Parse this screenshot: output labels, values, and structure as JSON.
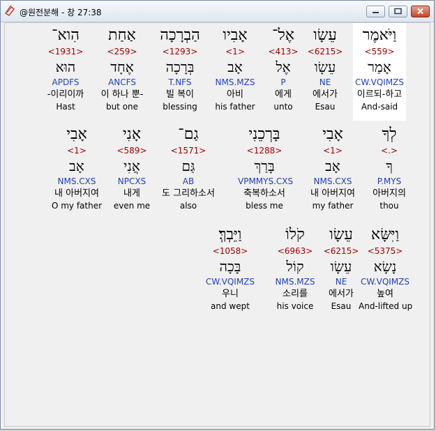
{
  "window": {
    "title": "@원전분해 - 창 27:38"
  },
  "colors": {
    "strong": "#a00000",
    "parse": "#1f3fb8",
    "selected_bg": "#ffffff"
  },
  "rows": [
    [
      {
        "heb": "וַיֹּאמֶר",
        "strong": "<559>",
        "lex": "אָמַר",
        "parse": "CW.VQIMZS",
        "kor": "이르되-하고",
        "eng": "And-said",
        "selected": true
      },
      {
        "heb": "עֵשָׂו",
        "strong": "<6215>",
        "lex": "עֵשָׂו",
        "parse": "NE",
        "kor": "에서가",
        "eng": "Esau"
      },
      {
        "heb": "אֶל־",
        "strong": "<413>",
        "lex": "אֶל",
        "parse": "P",
        "kor": "에게",
        "eng": "unto"
      },
      {
        "heb": "אָבִיו",
        "strong": "<1>",
        "lex": "אָב",
        "parse": "NMS.MZS",
        "kor": "아비",
        "eng": "his father"
      },
      {
        "heb": "הַבְרָכָה",
        "strong": "<1293>",
        "lex": "בְּרָכָה",
        "parse": "T.NFS",
        "kor": "빌 복이",
        "eng": "blessing"
      },
      {
        "heb": "אַחַת",
        "strong": "<259>",
        "lex": "אֶחָד",
        "parse": "ANCFS",
        "kor": "이 하나 뿐-",
        "eng": "but one"
      },
      {
        "heb": "הִוא־",
        "strong": "<1931>",
        "lex": "הוּא",
        "parse": "APDFS",
        "kor": "-이리이까",
        "eng": "Hast"
      }
    ],
    [
      {
        "heb": "לְךָ",
        "strong": "<.>",
        "lex": "ךָ",
        "parse": "P.MYS",
        "kor": "아버지의",
        "eng": "thou"
      },
      {
        "heb": "אָבִי",
        "strong": "<1>",
        "lex": "אָב",
        "parse": "NMS.CXS",
        "kor": "내 아버지여",
        "eng": "my father"
      },
      {
        "heb": "בָּרְכֵנִי",
        "strong": "<1288>",
        "lex": "בָּרַךְ",
        "parse": "VPMMYS.CXS",
        "kor": "축복하소서",
        "eng": "bless me"
      },
      {
        "heb": "גַם־",
        "strong": "<1571>",
        "lex": "גַּם",
        "parse": "AB",
        "kor": "도 그리하소서",
        "eng": "also"
      },
      {
        "heb": "אָנִי",
        "strong": "<589>",
        "lex": "אֲנִי",
        "parse": "NPCXS",
        "kor": "내게",
        "eng": "even me"
      },
      {
        "heb": "אָבִי",
        "strong": "<1>",
        "lex": "אָב",
        "parse": "NMS.CXS",
        "kor": "내 아버지여",
        "eng": "O my father"
      }
    ],
    [
      {
        "heb": "וַיִּשָּׂא",
        "strong": "<5375>",
        "lex": "נָשָׂא",
        "parse": "CW.VQIMZS",
        "kor": "높여",
        "eng": "And-lifted up"
      },
      {
        "heb": "עֵשָׂו",
        "strong": "<6215>",
        "lex": "עֵשָׂו",
        "parse": "NE",
        "kor": "에서가",
        "eng": "Esau"
      },
      {
        "heb": "קֹלוֹ",
        "strong": "<6963>",
        "lex": "קוֹל",
        "parse": "NMS.MZS",
        "kor": "소리를",
        "eng": "his voice"
      },
      {
        "heb": "וַיֵּבְךְּ׃",
        "strong": "<1058>",
        "lex": "בָּכָה",
        "parse": "CW.VQIMZS",
        "kor": "우니",
        "eng": "and wept"
      }
    ]
  ]
}
